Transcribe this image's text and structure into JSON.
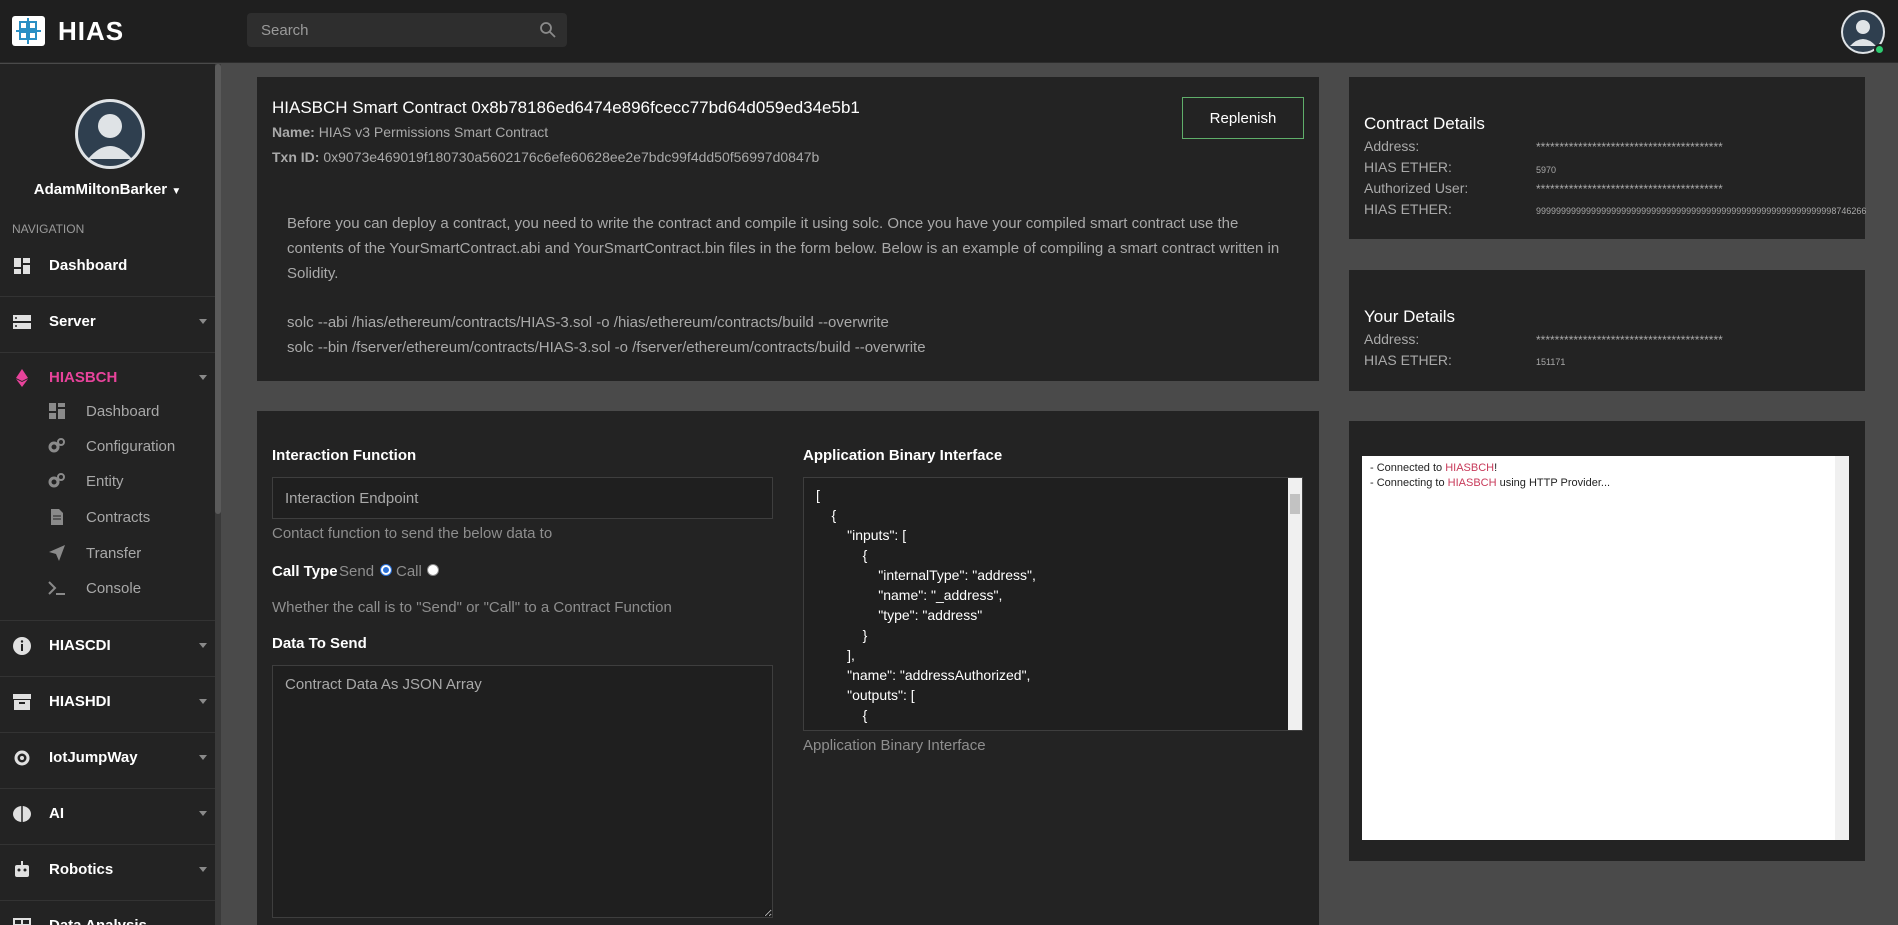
{
  "app": {
    "brand": "HIAS"
  },
  "search": {
    "placeholder": "Search"
  },
  "sidebar": {
    "user_name": "AdamMiltonBarker",
    "nav_heading": "NAVIGATION",
    "items": [
      {
        "label": "Dashboard",
        "icon": "dashboard-icon"
      },
      {
        "label": "Server",
        "icon": "server-icon"
      },
      {
        "label": "HIASBCH",
        "icon": "ethereum-icon"
      },
      {
        "label": "HIASCDI",
        "icon": "info-icon"
      },
      {
        "label": "HIASHDI",
        "icon": "archive-icon"
      },
      {
        "label": "IotJumpWay",
        "icon": "iot-icon"
      },
      {
        "label": "AI",
        "icon": "brain-icon"
      },
      {
        "label": "Robotics",
        "icon": "robot-icon"
      },
      {
        "label": "Data Analysis",
        "icon": "data-icon"
      }
    ],
    "hiasbch_sub": [
      {
        "label": "Dashboard"
      },
      {
        "label": "Configuration"
      },
      {
        "label": "Entity"
      },
      {
        "label": "Contracts"
      },
      {
        "label": "Transfer"
      },
      {
        "label": "Console"
      }
    ],
    "active_color": "#e8439b"
  },
  "contract": {
    "title": "HIASBCH Smart Contract 0x8b78186ed6474e896fcecc77bd64d059ed34e5b1",
    "name_label": "Name:",
    "name_value": "HIAS v3 Permissions Smart Contract",
    "txn_label": "Txn ID:",
    "txn_value": "0x9073e469019f180730a5602176c6efe60628ee2e7bdc99f4dd50f56997d0847b",
    "replenish": "Replenish",
    "intro": "Before you can deploy a contract, you need to write the contract and compile it using solc. Once you have your compiled smart contract use the contents of the YourSmartContract.abi and YourSmartContract.bin files in the form below. Below is an example of compiling a smart contract written in Solidity.",
    "cmd_abi": "solc --abi /hias/ethereum/contracts/HIAS-3.sol -o /hias/ethereum/contracts/build --overwrite",
    "cmd_bin": "solc --bin /fserver/ethereum/contracts/HIAS-3.sol -o /fserver/ethereum/contracts/build --overwrite"
  },
  "form": {
    "interaction_label": "Interaction Function",
    "interaction_placeholder": "Interaction Endpoint",
    "interaction_help": "Contact function to send the below data to",
    "call_type_label": "Call Type",
    "send_label": "Send",
    "call_label": "Call",
    "call_type_help": "Whether the call is to \"Send\" or \"Call\" to a Contract Function",
    "data_label": "Data To Send",
    "data_placeholder": "Contract Data As JSON Array",
    "abi_label": "Application Binary Interface",
    "abi_help": "Application Binary Interface",
    "abi_lines": [
      "[",
      "    {",
      "        \"inputs\": [",
      "            {",
      "                \"internalType\": \"address\",",
      "                \"name\": \"_address\",",
      "                \"type\": \"address\"",
      "            }",
      "        ],",
      "        \"name\": \"addressAuthorized\",",
      "        \"outputs\": [",
      "            {"
    ]
  },
  "contract_details": {
    "title": "Contract Details",
    "address_label": "Address:",
    "address_value": "****************************************",
    "ether_label": "HIAS ETHER:",
    "ether_value": "5970",
    "auth_user_label": "Authorized User:",
    "auth_user_value": "****************************************",
    "auth_ether_label": "HIAS ETHER:",
    "auth_ether_value": "999999999999999999999999999999999999999999999999999999999998746266"
  },
  "your_details": {
    "title": "Your Details",
    "address_label": "Address:",
    "address_value": "****************************************",
    "ether_label": "HIAS ETHER:",
    "ether_value": "151171"
  },
  "console": {
    "lines": [
      {
        "prefix": "- Connected to ",
        "hl": "HIASBCH",
        "suffix": "!"
      },
      {
        "prefix": "- Connecting to ",
        "hl": "HIASBCH",
        "suffix": " using HTTP Provider..."
      }
    ]
  }
}
